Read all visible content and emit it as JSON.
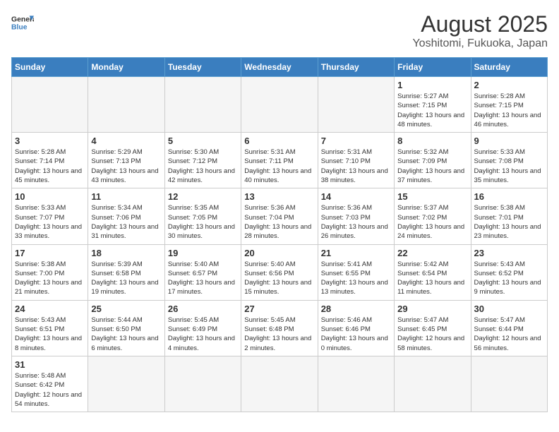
{
  "logo": {
    "text_general": "General",
    "text_blue": "Blue"
  },
  "title": "August 2025",
  "subtitle": "Yoshitomi, Fukuoka, Japan",
  "weekdays": [
    "Sunday",
    "Monday",
    "Tuesday",
    "Wednesday",
    "Thursday",
    "Friday",
    "Saturday"
  ],
  "weeks": [
    [
      {
        "day": "",
        "info": ""
      },
      {
        "day": "",
        "info": ""
      },
      {
        "day": "",
        "info": ""
      },
      {
        "day": "",
        "info": ""
      },
      {
        "day": "",
        "info": ""
      },
      {
        "day": "1",
        "info": "Sunrise: 5:27 AM\nSunset: 7:15 PM\nDaylight: 13 hours and 48 minutes."
      },
      {
        "day": "2",
        "info": "Sunrise: 5:28 AM\nSunset: 7:15 PM\nDaylight: 13 hours and 46 minutes."
      }
    ],
    [
      {
        "day": "3",
        "info": "Sunrise: 5:28 AM\nSunset: 7:14 PM\nDaylight: 13 hours and 45 minutes."
      },
      {
        "day": "4",
        "info": "Sunrise: 5:29 AM\nSunset: 7:13 PM\nDaylight: 13 hours and 43 minutes."
      },
      {
        "day": "5",
        "info": "Sunrise: 5:30 AM\nSunset: 7:12 PM\nDaylight: 13 hours and 42 minutes."
      },
      {
        "day": "6",
        "info": "Sunrise: 5:31 AM\nSunset: 7:11 PM\nDaylight: 13 hours and 40 minutes."
      },
      {
        "day": "7",
        "info": "Sunrise: 5:31 AM\nSunset: 7:10 PM\nDaylight: 13 hours and 38 minutes."
      },
      {
        "day": "8",
        "info": "Sunrise: 5:32 AM\nSunset: 7:09 PM\nDaylight: 13 hours and 37 minutes."
      },
      {
        "day": "9",
        "info": "Sunrise: 5:33 AM\nSunset: 7:08 PM\nDaylight: 13 hours and 35 minutes."
      }
    ],
    [
      {
        "day": "10",
        "info": "Sunrise: 5:33 AM\nSunset: 7:07 PM\nDaylight: 13 hours and 33 minutes."
      },
      {
        "day": "11",
        "info": "Sunrise: 5:34 AM\nSunset: 7:06 PM\nDaylight: 13 hours and 31 minutes."
      },
      {
        "day": "12",
        "info": "Sunrise: 5:35 AM\nSunset: 7:05 PM\nDaylight: 13 hours and 30 minutes."
      },
      {
        "day": "13",
        "info": "Sunrise: 5:36 AM\nSunset: 7:04 PM\nDaylight: 13 hours and 28 minutes."
      },
      {
        "day": "14",
        "info": "Sunrise: 5:36 AM\nSunset: 7:03 PM\nDaylight: 13 hours and 26 minutes."
      },
      {
        "day": "15",
        "info": "Sunrise: 5:37 AM\nSunset: 7:02 PM\nDaylight: 13 hours and 24 minutes."
      },
      {
        "day": "16",
        "info": "Sunrise: 5:38 AM\nSunset: 7:01 PM\nDaylight: 13 hours and 23 minutes."
      }
    ],
    [
      {
        "day": "17",
        "info": "Sunrise: 5:38 AM\nSunset: 7:00 PM\nDaylight: 13 hours and 21 minutes."
      },
      {
        "day": "18",
        "info": "Sunrise: 5:39 AM\nSunset: 6:58 PM\nDaylight: 13 hours and 19 minutes."
      },
      {
        "day": "19",
        "info": "Sunrise: 5:40 AM\nSunset: 6:57 PM\nDaylight: 13 hours and 17 minutes."
      },
      {
        "day": "20",
        "info": "Sunrise: 5:40 AM\nSunset: 6:56 PM\nDaylight: 13 hours and 15 minutes."
      },
      {
        "day": "21",
        "info": "Sunrise: 5:41 AM\nSunset: 6:55 PM\nDaylight: 13 hours and 13 minutes."
      },
      {
        "day": "22",
        "info": "Sunrise: 5:42 AM\nSunset: 6:54 PM\nDaylight: 13 hours and 11 minutes."
      },
      {
        "day": "23",
        "info": "Sunrise: 5:43 AM\nSunset: 6:52 PM\nDaylight: 13 hours and 9 minutes."
      }
    ],
    [
      {
        "day": "24",
        "info": "Sunrise: 5:43 AM\nSunset: 6:51 PM\nDaylight: 13 hours and 8 minutes."
      },
      {
        "day": "25",
        "info": "Sunrise: 5:44 AM\nSunset: 6:50 PM\nDaylight: 13 hours and 6 minutes."
      },
      {
        "day": "26",
        "info": "Sunrise: 5:45 AM\nSunset: 6:49 PM\nDaylight: 13 hours and 4 minutes."
      },
      {
        "day": "27",
        "info": "Sunrise: 5:45 AM\nSunset: 6:48 PM\nDaylight: 13 hours and 2 minutes."
      },
      {
        "day": "28",
        "info": "Sunrise: 5:46 AM\nSunset: 6:46 PM\nDaylight: 13 hours and 0 minutes."
      },
      {
        "day": "29",
        "info": "Sunrise: 5:47 AM\nSunset: 6:45 PM\nDaylight: 12 hours and 58 minutes."
      },
      {
        "day": "30",
        "info": "Sunrise: 5:47 AM\nSunset: 6:44 PM\nDaylight: 12 hours and 56 minutes."
      }
    ],
    [
      {
        "day": "31",
        "info": "Sunrise: 5:48 AM\nSunset: 6:42 PM\nDaylight: 12 hours and 54 minutes."
      },
      {
        "day": "",
        "info": ""
      },
      {
        "day": "",
        "info": ""
      },
      {
        "day": "",
        "info": ""
      },
      {
        "day": "",
        "info": ""
      },
      {
        "day": "",
        "info": ""
      },
      {
        "day": "",
        "info": ""
      }
    ]
  ]
}
